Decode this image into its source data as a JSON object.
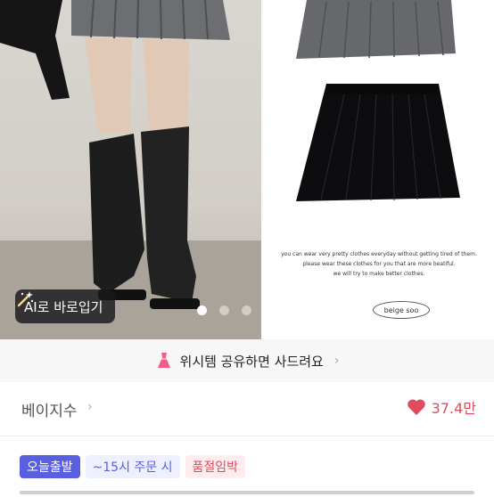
{
  "gallery": {
    "ai_button_label": "AI로 바로입기",
    "slide_count": 3,
    "active_slide": 1,
    "caption_lines": [
      "you can wear very pretty clothes everyday without getting tired of them.",
      "please wear these clothes for you that are more beatiful.",
      "we will try to make better clothes."
    ],
    "brand_mark": "beige soo"
  },
  "wish_banner": {
    "label": "위시템 공유하면 사드려요"
  },
  "shop": {
    "name": "베이지수",
    "like_count": "37.4만"
  },
  "badges": [
    "오늘출발",
    "~15시 주문 시",
    "품절임박"
  ],
  "colors": {
    "accent": "#5a5fe0",
    "heart": "#e04b5e",
    "banner_bg": "#f7f7f8"
  }
}
